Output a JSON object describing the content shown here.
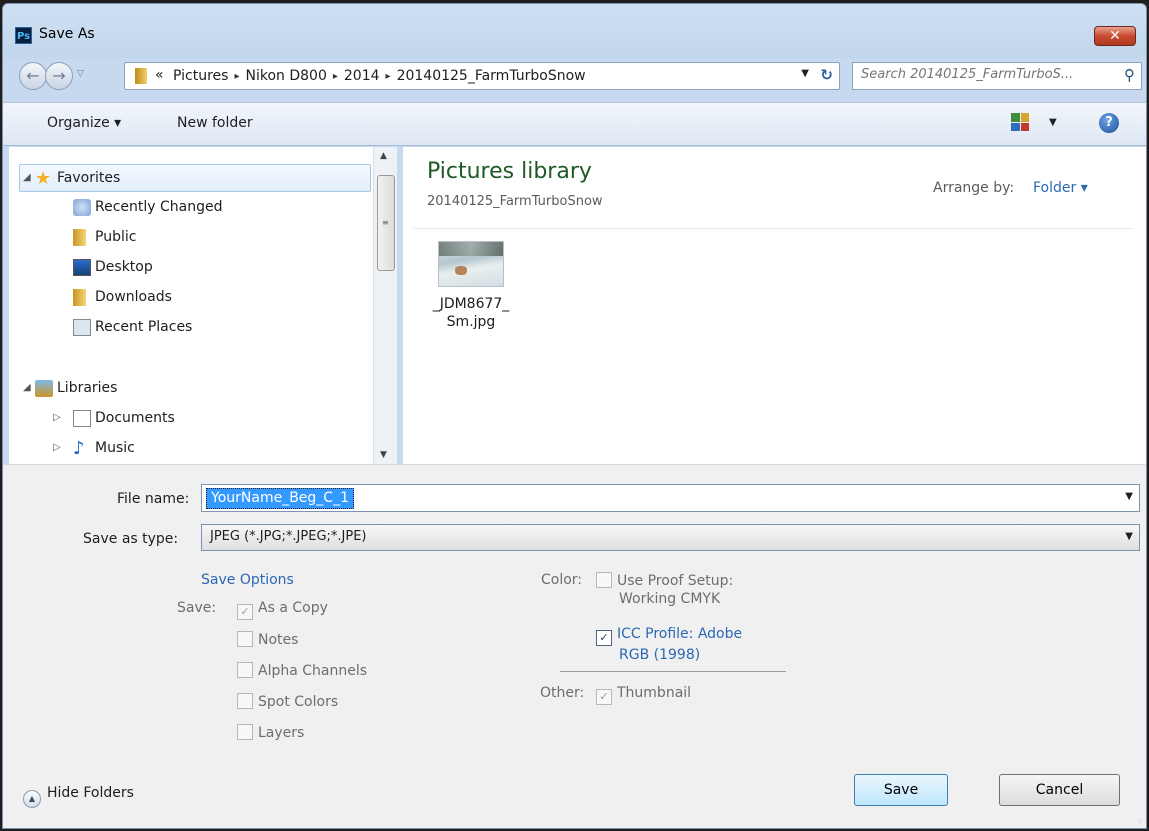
{
  "window": {
    "title": "Save As",
    "app_badge": "Ps",
    "close_glyph": "✕"
  },
  "nav": {
    "back_glyph": "←",
    "forward_glyph": "→",
    "history_glyph": "▽",
    "breadcrumb": [
      "Pictures",
      "Nikon D800",
      "2014",
      "20140125_FarmTurboSnow"
    ],
    "breadcrumb_prefix": "«",
    "breadcrumb_separator": "▸",
    "address_dropdown_glyph": "▼",
    "refresh_glyph": "↻",
    "search_placeholder": "Search 20140125_FarmTurboS...",
    "search_glyph": "⚲"
  },
  "toolbar": {
    "organize_label": "Organize ▾",
    "new_folder_label": "New folder",
    "views_dropdown_glyph": "▼",
    "help_glyph": "?"
  },
  "sidebar": {
    "favorites": {
      "label": "Favorites",
      "icon": "star-icon",
      "expand": "◢"
    },
    "favorite_items": [
      {
        "label": "Recently Changed",
        "icon": "recent-changes-icon"
      },
      {
        "label": "Public",
        "icon": "folder-icon"
      },
      {
        "label": "Desktop",
        "icon": "desktop-icon"
      },
      {
        "label": "Downloads",
        "icon": "downloads-icon"
      },
      {
        "label": "Recent Places",
        "icon": "recent-places-icon"
      }
    ],
    "libraries": {
      "label": "Libraries",
      "icon": "libraries-icon",
      "expand": "◢"
    },
    "library_items": [
      {
        "label": "Documents",
        "icon": "documents-icon",
        "expand": "▷"
      },
      {
        "label": "Music",
        "icon": "music-icon",
        "expand": "▷"
      }
    ],
    "scroll_up": "▲",
    "scroll_down": "▼",
    "thumb_grip": "≡"
  },
  "content": {
    "library_title": "Pictures library",
    "library_subtitle": "20140125_FarmTurboSnow",
    "arrange_label": "Arrange by:",
    "arrange_value": "Folder ▾",
    "files": [
      {
        "name_line1": "_JDM8677_",
        "name_line2": "Sm.jpg"
      }
    ]
  },
  "form": {
    "file_name_label": "File name:",
    "file_name_value": "YourName_Beg_C_1",
    "save_type_label": "Save as type:",
    "save_type_value": "JPEG (*.JPG;*.JPEG;*.JPE)",
    "dropdown_glyph": "▼"
  },
  "save_options": {
    "title": "Save Options",
    "save_label": "Save:",
    "as_a_copy": "As a Copy",
    "notes": "Notes",
    "alpha_channels": "Alpha Channels",
    "spot_colors": "Spot Colors",
    "layers": "Layers",
    "color_label": "Color:",
    "use_proof_line1": "Use Proof Setup:",
    "use_proof_line2": "Working CMYK",
    "icc_line1": "ICC Profile:  Adobe",
    "icc_line2": "RGB (1998)",
    "other_label": "Other:",
    "thumbnail": "Thumbnail",
    "check_glyph": "✓"
  },
  "footer": {
    "hide_folders": "Hide Folders",
    "hide_glyph": "▲",
    "save_button": "Save",
    "cancel_button": "Cancel",
    "grip": "⁖"
  },
  "colors": {
    "accent_blue": "#2c68b4",
    "library_green": "#1e5a25",
    "selection": "#3399ff",
    "close_red": "#c74a30"
  }
}
